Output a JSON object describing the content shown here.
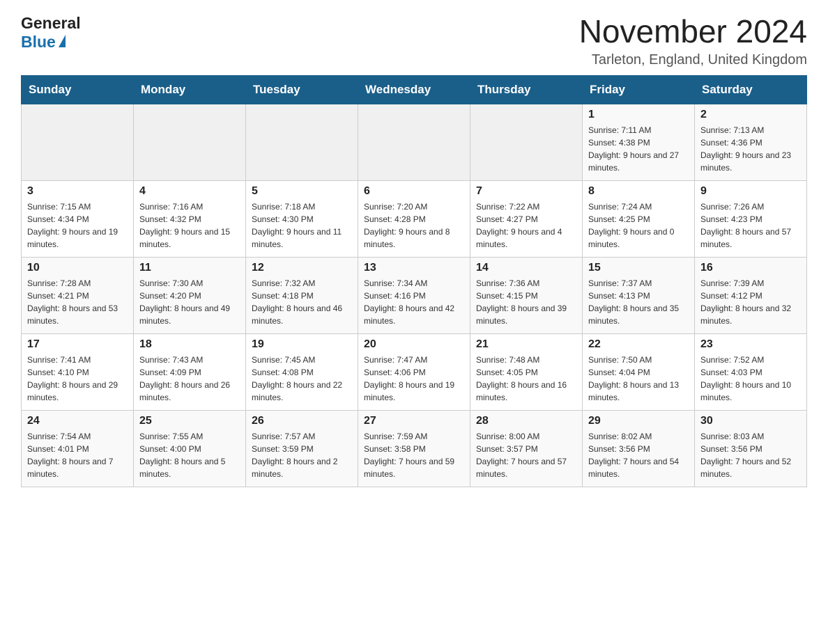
{
  "header": {
    "month_title": "November 2024",
    "location": "Tarleton, England, United Kingdom",
    "logo_general": "General",
    "logo_blue": "Blue"
  },
  "weekdays": [
    "Sunday",
    "Monday",
    "Tuesday",
    "Wednesday",
    "Thursday",
    "Friday",
    "Saturday"
  ],
  "weeks": [
    [
      {
        "day": "",
        "sunrise": "",
        "sunset": "",
        "daylight": ""
      },
      {
        "day": "",
        "sunrise": "",
        "sunset": "",
        "daylight": ""
      },
      {
        "day": "",
        "sunrise": "",
        "sunset": "",
        "daylight": ""
      },
      {
        "day": "",
        "sunrise": "",
        "sunset": "",
        "daylight": ""
      },
      {
        "day": "",
        "sunrise": "",
        "sunset": "",
        "daylight": ""
      },
      {
        "day": "1",
        "sunrise": "Sunrise: 7:11 AM",
        "sunset": "Sunset: 4:38 PM",
        "daylight": "Daylight: 9 hours and 27 minutes."
      },
      {
        "day": "2",
        "sunrise": "Sunrise: 7:13 AM",
        "sunset": "Sunset: 4:36 PM",
        "daylight": "Daylight: 9 hours and 23 minutes."
      }
    ],
    [
      {
        "day": "3",
        "sunrise": "Sunrise: 7:15 AM",
        "sunset": "Sunset: 4:34 PM",
        "daylight": "Daylight: 9 hours and 19 minutes."
      },
      {
        "day": "4",
        "sunrise": "Sunrise: 7:16 AM",
        "sunset": "Sunset: 4:32 PM",
        "daylight": "Daylight: 9 hours and 15 minutes."
      },
      {
        "day": "5",
        "sunrise": "Sunrise: 7:18 AM",
        "sunset": "Sunset: 4:30 PM",
        "daylight": "Daylight: 9 hours and 11 minutes."
      },
      {
        "day": "6",
        "sunrise": "Sunrise: 7:20 AM",
        "sunset": "Sunset: 4:28 PM",
        "daylight": "Daylight: 9 hours and 8 minutes."
      },
      {
        "day": "7",
        "sunrise": "Sunrise: 7:22 AM",
        "sunset": "Sunset: 4:27 PM",
        "daylight": "Daylight: 9 hours and 4 minutes."
      },
      {
        "day": "8",
        "sunrise": "Sunrise: 7:24 AM",
        "sunset": "Sunset: 4:25 PM",
        "daylight": "Daylight: 9 hours and 0 minutes."
      },
      {
        "day": "9",
        "sunrise": "Sunrise: 7:26 AM",
        "sunset": "Sunset: 4:23 PM",
        "daylight": "Daylight: 8 hours and 57 minutes."
      }
    ],
    [
      {
        "day": "10",
        "sunrise": "Sunrise: 7:28 AM",
        "sunset": "Sunset: 4:21 PM",
        "daylight": "Daylight: 8 hours and 53 minutes."
      },
      {
        "day": "11",
        "sunrise": "Sunrise: 7:30 AM",
        "sunset": "Sunset: 4:20 PM",
        "daylight": "Daylight: 8 hours and 49 minutes."
      },
      {
        "day": "12",
        "sunrise": "Sunrise: 7:32 AM",
        "sunset": "Sunset: 4:18 PM",
        "daylight": "Daylight: 8 hours and 46 minutes."
      },
      {
        "day": "13",
        "sunrise": "Sunrise: 7:34 AM",
        "sunset": "Sunset: 4:16 PM",
        "daylight": "Daylight: 8 hours and 42 minutes."
      },
      {
        "day": "14",
        "sunrise": "Sunrise: 7:36 AM",
        "sunset": "Sunset: 4:15 PM",
        "daylight": "Daylight: 8 hours and 39 minutes."
      },
      {
        "day": "15",
        "sunrise": "Sunrise: 7:37 AM",
        "sunset": "Sunset: 4:13 PM",
        "daylight": "Daylight: 8 hours and 35 minutes."
      },
      {
        "day": "16",
        "sunrise": "Sunrise: 7:39 AM",
        "sunset": "Sunset: 4:12 PM",
        "daylight": "Daylight: 8 hours and 32 minutes."
      }
    ],
    [
      {
        "day": "17",
        "sunrise": "Sunrise: 7:41 AM",
        "sunset": "Sunset: 4:10 PM",
        "daylight": "Daylight: 8 hours and 29 minutes."
      },
      {
        "day": "18",
        "sunrise": "Sunrise: 7:43 AM",
        "sunset": "Sunset: 4:09 PM",
        "daylight": "Daylight: 8 hours and 26 minutes."
      },
      {
        "day": "19",
        "sunrise": "Sunrise: 7:45 AM",
        "sunset": "Sunset: 4:08 PM",
        "daylight": "Daylight: 8 hours and 22 minutes."
      },
      {
        "day": "20",
        "sunrise": "Sunrise: 7:47 AM",
        "sunset": "Sunset: 4:06 PM",
        "daylight": "Daylight: 8 hours and 19 minutes."
      },
      {
        "day": "21",
        "sunrise": "Sunrise: 7:48 AM",
        "sunset": "Sunset: 4:05 PM",
        "daylight": "Daylight: 8 hours and 16 minutes."
      },
      {
        "day": "22",
        "sunrise": "Sunrise: 7:50 AM",
        "sunset": "Sunset: 4:04 PM",
        "daylight": "Daylight: 8 hours and 13 minutes."
      },
      {
        "day": "23",
        "sunrise": "Sunrise: 7:52 AM",
        "sunset": "Sunset: 4:03 PM",
        "daylight": "Daylight: 8 hours and 10 minutes."
      }
    ],
    [
      {
        "day": "24",
        "sunrise": "Sunrise: 7:54 AM",
        "sunset": "Sunset: 4:01 PM",
        "daylight": "Daylight: 8 hours and 7 minutes."
      },
      {
        "day": "25",
        "sunrise": "Sunrise: 7:55 AM",
        "sunset": "Sunset: 4:00 PM",
        "daylight": "Daylight: 8 hours and 5 minutes."
      },
      {
        "day": "26",
        "sunrise": "Sunrise: 7:57 AM",
        "sunset": "Sunset: 3:59 PM",
        "daylight": "Daylight: 8 hours and 2 minutes."
      },
      {
        "day": "27",
        "sunrise": "Sunrise: 7:59 AM",
        "sunset": "Sunset: 3:58 PM",
        "daylight": "Daylight: 7 hours and 59 minutes."
      },
      {
        "day": "28",
        "sunrise": "Sunrise: 8:00 AM",
        "sunset": "Sunset: 3:57 PM",
        "daylight": "Daylight: 7 hours and 57 minutes."
      },
      {
        "day": "29",
        "sunrise": "Sunrise: 8:02 AM",
        "sunset": "Sunset: 3:56 PM",
        "daylight": "Daylight: 7 hours and 54 minutes."
      },
      {
        "day": "30",
        "sunrise": "Sunrise: 8:03 AM",
        "sunset": "Sunset: 3:56 PM",
        "daylight": "Daylight: 7 hours and 52 minutes."
      }
    ]
  ]
}
